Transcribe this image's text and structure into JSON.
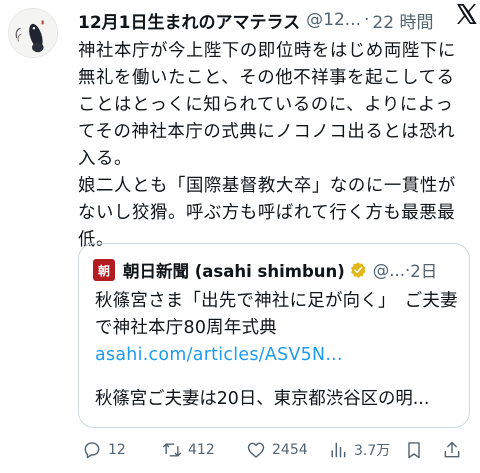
{
  "tweet": {
    "display_name": "12月1日生まれのアマテラス",
    "handle": "@12...",
    "separator": "·",
    "time": "22 時間",
    "paragraphs": [
      "神社本庁が今上陛下の即位時をはじめ両陛下に無礼を働いたこと、その他不祥事を起こしてることはとっくに知られているのに、よりによってその神社本庁の式典にノコノコ出るとは恐れ入る。",
      "娘二人とも「国際基督教大卒」なのに一貫性がないし狡猾。呼ぶ方も呼ばれて行く方も最悪最低。"
    ]
  },
  "quote": {
    "logo_text": "朝",
    "name": "朝日新聞 (asahi shimbun)",
    "handle": "@...",
    "separator": "·",
    "time": "2日",
    "text": "秋篠宮さま「出先で神社に足が向く」　ご夫妻で神社本庁80周年式典 ",
    "link": "asahi.com/articles/ASV5N...",
    "preview": "秋篠宮ご夫妻は20日、東京都渋谷区の明..."
  },
  "actions": {
    "replies": "12",
    "retweets": "412",
    "likes": "2454",
    "views": "3.7万"
  },
  "colors": {
    "text": "#0f1419",
    "secondary": "#536471",
    "link": "#1d9bf0",
    "verified": "#e2b719",
    "asahi_red": "#b21c22"
  },
  "icons": [
    "avatar-image",
    "x-logo-icon",
    "asahi-logo-icon",
    "verified-badge-icon",
    "reply-icon",
    "retweet-icon",
    "like-icon",
    "views-icon",
    "bookmark-icon",
    "share-icon"
  ]
}
